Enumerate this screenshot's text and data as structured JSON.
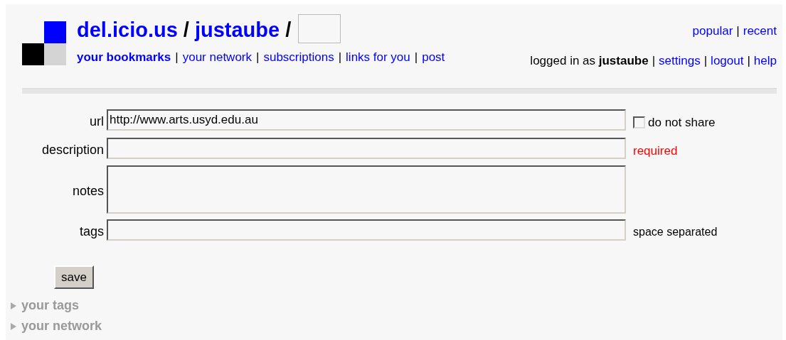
{
  "header": {
    "title": [
      {
        "kind": "link",
        "text": "del.icio.us"
      },
      {
        "kind": "sep",
        "text": "/"
      },
      {
        "kind": "link",
        "text": "justaube"
      },
      {
        "kind": "sep",
        "text": "/"
      },
      {
        "kind": "field"
      }
    ],
    "nav": [
      {
        "kind": "link",
        "text": "your bookmarks",
        "selected": true
      },
      {
        "kind": "sep",
        "text": "|"
      },
      {
        "kind": "link",
        "text": "your network",
        "selected": false
      },
      {
        "kind": "sep",
        "text": "|"
      },
      {
        "kind": "link",
        "text": "subscriptions",
        "selected": false
      },
      {
        "kind": "sep",
        "text": "|"
      },
      {
        "kind": "link",
        "text": "links for you",
        "selected": false
      },
      {
        "kind": "sep",
        "text": "|"
      },
      {
        "kind": "link",
        "text": "post",
        "selected": false
      }
    ],
    "top_links": [
      {
        "kind": "link",
        "text": "popular"
      },
      {
        "kind": "sep",
        "text": "|"
      },
      {
        "kind": "link",
        "text": "recent"
      }
    ],
    "user_links": [
      {
        "kind": "text",
        "text": "logged in as **justaube**"
      },
      {
        "kind": "sep",
        "text": "|"
      },
      {
        "kind": "link",
        "text": "settings"
      },
      {
        "kind": "sep",
        "text": "|"
      },
      {
        "kind": "link",
        "text": "logout"
      },
      {
        "kind": "sep",
        "text": "|"
      },
      {
        "kind": "link",
        "text": "help"
      }
    ]
  },
  "form": {
    "fields": [
      {
        "label": "url",
        "kind": "input",
        "value": "http://www.arts.usyd.edu.au",
        "side": {
          "kind": "checkbox",
          "text": "do not share",
          "checked": false
        }
      },
      {
        "label": "description",
        "kind": "input",
        "side": {
          "kind": "required",
          "text": "required"
        }
      },
      {
        "label": "notes",
        "kind": "textarea"
      },
      {
        "label": "tags",
        "kind": "input",
        "side": {
          "kind": "hint",
          "text": "space separated"
        }
      }
    ],
    "button": "save"
  },
  "sections": [
    {
      "text": "your tags",
      "expanded": false
    },
    {
      "text": "your network",
      "expanded": false
    }
  ]
}
